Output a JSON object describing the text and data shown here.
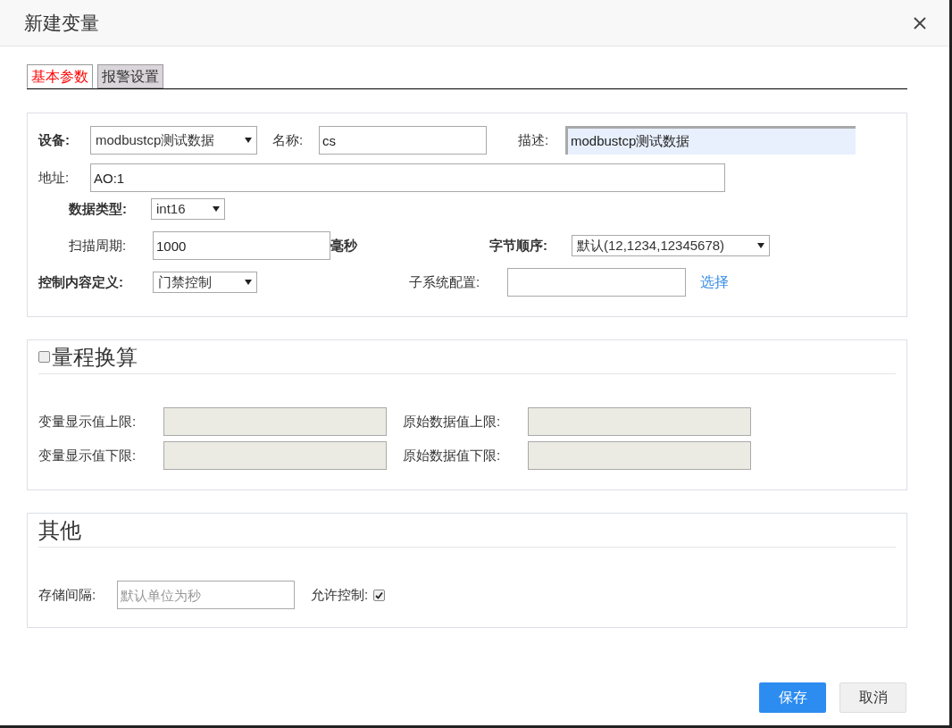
{
  "dialog": {
    "title": "新建变量"
  },
  "tabs": [
    {
      "label": "基本参数",
      "selected": true
    },
    {
      "label": "报警设置",
      "selected": false
    }
  ],
  "basic": {
    "device": {
      "label": "设备:",
      "value": "modbustcp测试数据"
    },
    "name": {
      "label": "名称:",
      "value": "cs"
    },
    "description": {
      "label": "描述:",
      "value": "modbustcp测试数据"
    },
    "address": {
      "label": "地址:",
      "value": "AO:1"
    },
    "data_type": {
      "label": "数据类型:",
      "value": "int16"
    },
    "scan_period": {
      "label": "扫描周期:",
      "value": "1000",
      "unit": "毫秒"
    },
    "byte_order": {
      "label": "字节顺序:",
      "value": "默认(12,1234,12345678)"
    },
    "control_content": {
      "label": "控制内容定义:",
      "value": "门禁控制"
    },
    "subsystem": {
      "label": "子系统配置:",
      "link": "选择"
    }
  },
  "scale": {
    "title": "量程换算",
    "checked": false,
    "fields": [
      {
        "label": "变量显示值上限:",
        "disabled": true
      },
      {
        "label": "原始数据值上限:",
        "disabled": true
      },
      {
        "label": "变量显示值下限:",
        "disabled": true
      },
      {
        "label": "原始数据值下限:",
        "disabled": true
      }
    ]
  },
  "other": {
    "title": "其他",
    "storage": {
      "label": "存储间隔:",
      "placeholder": "默认单位为秒"
    },
    "allow_control": {
      "label": "允许控制:",
      "checked": true
    }
  },
  "buttons": [
    {
      "label": "保存",
      "kind": "primary"
    },
    {
      "label": "取消",
      "kind": "secondary"
    }
  ]
}
